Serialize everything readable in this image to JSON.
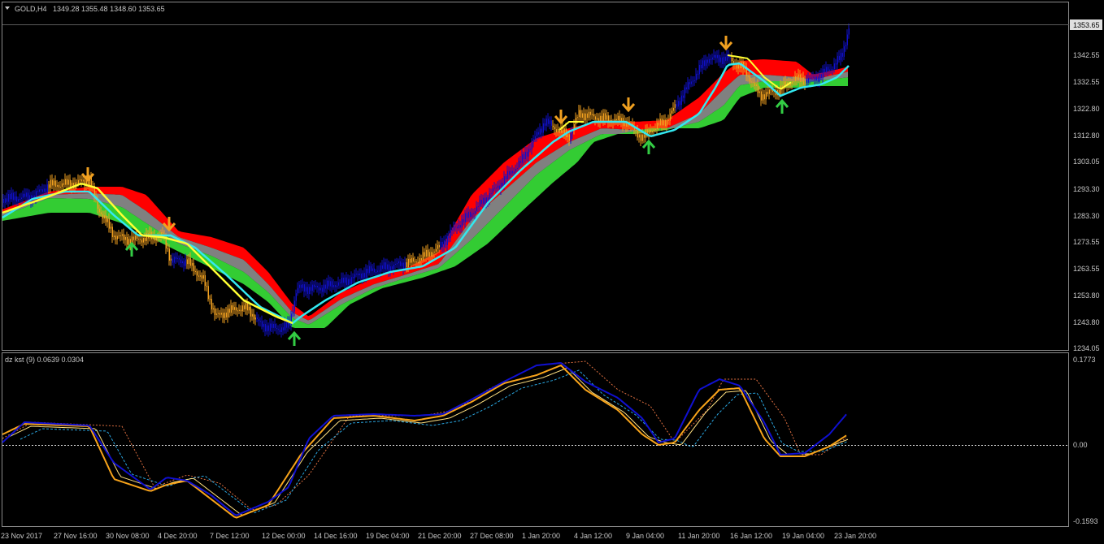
{
  "main": {
    "symbol": "GOLD,H4",
    "ohlc": "1349.28 1355.48 1348.60 1353.65",
    "current_price": "1353.65",
    "price_ticks": [
      "1342.55",
      "1332.55",
      "1322.80",
      "1312.80",
      "1303.05",
      "1293.30",
      "1283.30",
      "1273.55",
      "1263.55",
      "1253.80",
      "1243.80",
      "1234.05"
    ]
  },
  "sub": {
    "label": "dz kst (9) 0.0639 0.0304",
    "ticks": [
      "0.1773",
      "0.00",
      "-0.1593"
    ]
  },
  "time_axis": [
    "23 Nov 2017",
    "27 Nov 16:00",
    "30 Nov 08:00",
    "4 Dec 20:00",
    "7 Dec 12:00",
    "12 Dec 00:00",
    "14 Dec 16:00",
    "19 Dec 04:00",
    "21 Dec 20:00",
    "27 Dec 08:00",
    "1 Jan 20:00",
    "4 Jan 12:00",
    "9 Jan 04:00",
    "11 Jan 20:00",
    "16 Jan 12:00",
    "19 Jan 04:00",
    "23 Jan 20:00"
  ],
  "colors": {
    "bull": "#1010c8",
    "bear": "#f0a020",
    "band_red": "#ff0000",
    "band_gray": "#808080",
    "band_green": "#33cc33",
    "fast": "#ffff33",
    "signal": "#33e8f0",
    "osc_main": "#1010d0",
    "osc_orange": "#f7a31a",
    "osc_light": "#ffe080",
    "osc_cyan": "#2aa6e0",
    "osc_dotted": "#e07040"
  },
  "markers": {
    "sell_icon": "arrow-down-icon",
    "buy_icon": "arrow-up-icon"
  }
}
